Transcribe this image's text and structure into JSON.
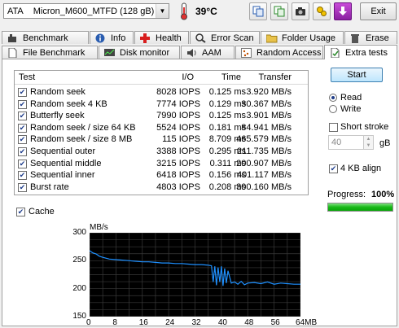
{
  "drive": {
    "bus": "ATA",
    "model": "Micron_M600_MTFD (128 gB)"
  },
  "temperature": "39°C",
  "toolbar": {
    "exit_label": "Exit"
  },
  "tabs_row1": [
    "Benchmark",
    "Info",
    "Health",
    "Error Scan",
    "Folder Usage",
    "Erase"
  ],
  "tabs_row2": [
    "File Benchmark",
    "Disk monitor",
    "AAM",
    "Random Access",
    "Extra tests"
  ],
  "active_tab": "Extra tests",
  "table": {
    "headers": {
      "test": "Test",
      "io": "I/O",
      "time": "Time",
      "transfer": "Transfer"
    },
    "rows": [
      {
        "test": "Random seek",
        "io": "8028 IOPS",
        "time": "0.125 ms",
        "transfer": "3.920 MB/s"
      },
      {
        "test": "Random seek 4 KB",
        "io": "7774 IOPS",
        "time": "0.129 ms",
        "transfer": "30.367 MB/s"
      },
      {
        "test": "Butterfly seek",
        "io": "7990 IOPS",
        "time": "0.125 ms",
        "transfer": "3.901 MB/s"
      },
      {
        "test": "Random seek / size 64 KB",
        "io": "5524 IOPS",
        "time": "0.181 ms",
        "transfer": "84.941 MB/s"
      },
      {
        "test": "Random seek / size 8 MB",
        "io": "115 IOPS",
        "time": "8.709 ms",
        "transfer": "465.579 MB/s"
      },
      {
        "test": "Sequential outer",
        "io": "3388 IOPS",
        "time": "0.295 ms",
        "transfer": "211.735 MB/s"
      },
      {
        "test": "Sequential middle",
        "io": "3215 IOPS",
        "time": "0.311 ms",
        "transfer": "200.907 MB/s"
      },
      {
        "test": "Sequential inner",
        "io": "6418 IOPS",
        "time": "0.156 ms",
        "transfer": "401.117 MB/s"
      },
      {
        "test": "Burst rate",
        "io": "4803 IOPS",
        "time": "0.208 ms",
        "transfer": "300.160 MB/s"
      }
    ]
  },
  "controls": {
    "start_label": "Start",
    "read_label": "Read",
    "write_label": "Write",
    "mode": "read",
    "short_stroke_label": "Short stroke",
    "short_stroke_value": "40",
    "short_stroke_unit": "gB",
    "align_label": "4 KB align",
    "progress_label": "Progress:",
    "progress_value": "100%",
    "progress_fraction": 1.0,
    "cache_label": "Cache"
  },
  "colors": {
    "accent": "#1e90ff",
    "progress": "#17b817",
    "temp_icon": "#e03030"
  },
  "chart_data": {
    "type": "line",
    "ylabel": "MB/s",
    "xlabel": "MB",
    "ylim": [
      150,
      300
    ],
    "xlim": [
      0,
      64
    ],
    "yticks": [
      "300",
      "250",
      "200",
      "150"
    ],
    "xticks": [
      "0",
      "8",
      "16",
      "24",
      "32",
      "40",
      "48",
      "56",
      "64MB"
    ],
    "series": [
      {
        "values_x": [
          0,
          1,
          2,
          3,
          4,
          6,
          8,
          10,
          12,
          14,
          16,
          18,
          20,
          22,
          24,
          26,
          28,
          30,
          32,
          34,
          36,
          37,
          37.5,
          38,
          38.5,
          39,
          39.5,
          40,
          40.5,
          41,
          41.5,
          42,
          43,
          44,
          45,
          46,
          47,
          48,
          50,
          52,
          54,
          56,
          58,
          60,
          62,
          64
        ],
        "values_y": [
          268,
          264,
          262,
          258,
          256,
          253,
          252,
          251,
          250,
          249,
          248,
          248,
          247,
          246,
          246,
          245,
          245,
          244,
          243,
          243,
          242,
          241,
          212,
          240,
          206,
          238,
          212,
          240,
          205,
          236,
          210,
          232,
          210,
          212,
          208,
          213,
          207,
          210,
          211,
          209,
          212,
          208,
          210,
          209,
          208,
          208
        ]
      }
    ]
  }
}
